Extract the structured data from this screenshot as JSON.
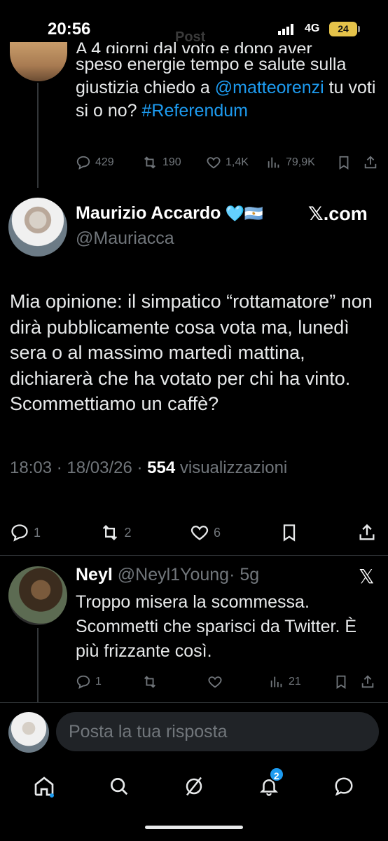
{
  "status_bar": {
    "time": "20:56",
    "network": "4G",
    "battery": "24"
  },
  "ghost_header": "Post",
  "previous_post": {
    "text_line1": "A 4 giorni dal voto e dopo aver",
    "text_body": "speso energie tempo e salute sulla giustizia chiedo a ",
    "mention": "@matteorenzi",
    "text_mid": " tu voti si o no? ",
    "hashtag": "#Referendum",
    "actions": {
      "replies": "429",
      "reposts": "190",
      "likes": "1,4K",
      "views": "79,9K"
    }
  },
  "main_post": {
    "author_name": "Maurizio Accardo",
    "author_emojis": "🩵🇦🇷",
    "author_handle": "@Mauriacca",
    "brand": "𝕏.com",
    "text": "Mia opinione: il simpatico “rottamatore” non dirà pubblicamente cosa vota ma, lunedì sera o al massimo martedì mattina, dichiarerà che ha votato per chi ha vinto. Scommettiamo un caffè?",
    "timestamp": "18:03 · 18/03/26 · ",
    "views_count": "554",
    "views_label": " visualizzazioni",
    "actions": {
      "replies": "1",
      "reposts": "2",
      "likes": "6"
    }
  },
  "reply": {
    "author_name": "Neyl",
    "author_handle": "@Neyl1Young",
    "age": "· 5g",
    "text": "Troppo misera la scommessa. Scommetti che sparisci da Twitter. È più frizzante così.",
    "actions": {
      "replies": "1",
      "views": "21"
    }
  },
  "composer": {
    "placeholder": "Posta la tua risposta"
  },
  "nav": {
    "notifications_badge": "2"
  },
  "colors": {
    "accent": "#1d9bf0",
    "muted": "#71767b",
    "background": "#000000"
  }
}
